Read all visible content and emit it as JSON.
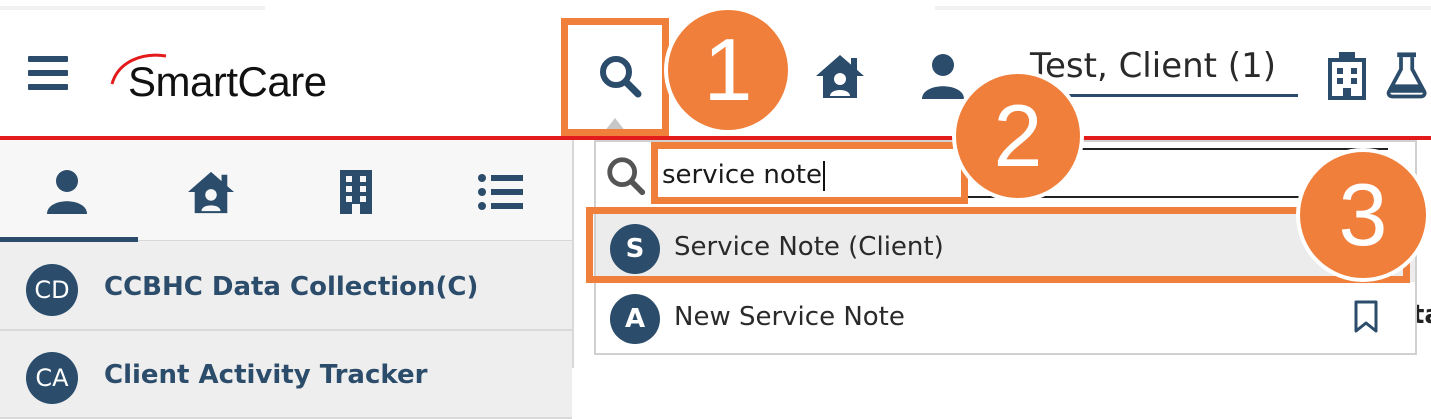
{
  "app": {
    "logo_text": "SmartCare",
    "client_name": "Test, Client (1)"
  },
  "callouts": [
    "1",
    "2",
    "3"
  ],
  "search": {
    "value": "service note"
  },
  "results": [
    {
      "avatar": "S",
      "label": "Service Note (Client)"
    },
    {
      "avatar": "A",
      "label": "New Service Note"
    }
  ],
  "sidebar": {
    "items": [
      {
        "avatar": "CD",
        "label": "CCBHC Data Collection(C)"
      },
      {
        "avatar": "CA",
        "label": "Client Activity Tracker"
      }
    ]
  },
  "behind_text": "ta",
  "icons": {
    "menu": "hamburger-icon",
    "search": "search-icon",
    "home": "home-user-icon",
    "user": "user-icon",
    "hospital": "hospital-icon",
    "flask": "flask-icon",
    "bookmark": "bookmark-icon",
    "tabs": [
      "client-icon",
      "home-user-icon",
      "building-icon",
      "list-icon"
    ]
  },
  "colors": {
    "primary": "#2b4c6a",
    "accent_red": "#e31b1b",
    "callout": "#f07f3c"
  }
}
